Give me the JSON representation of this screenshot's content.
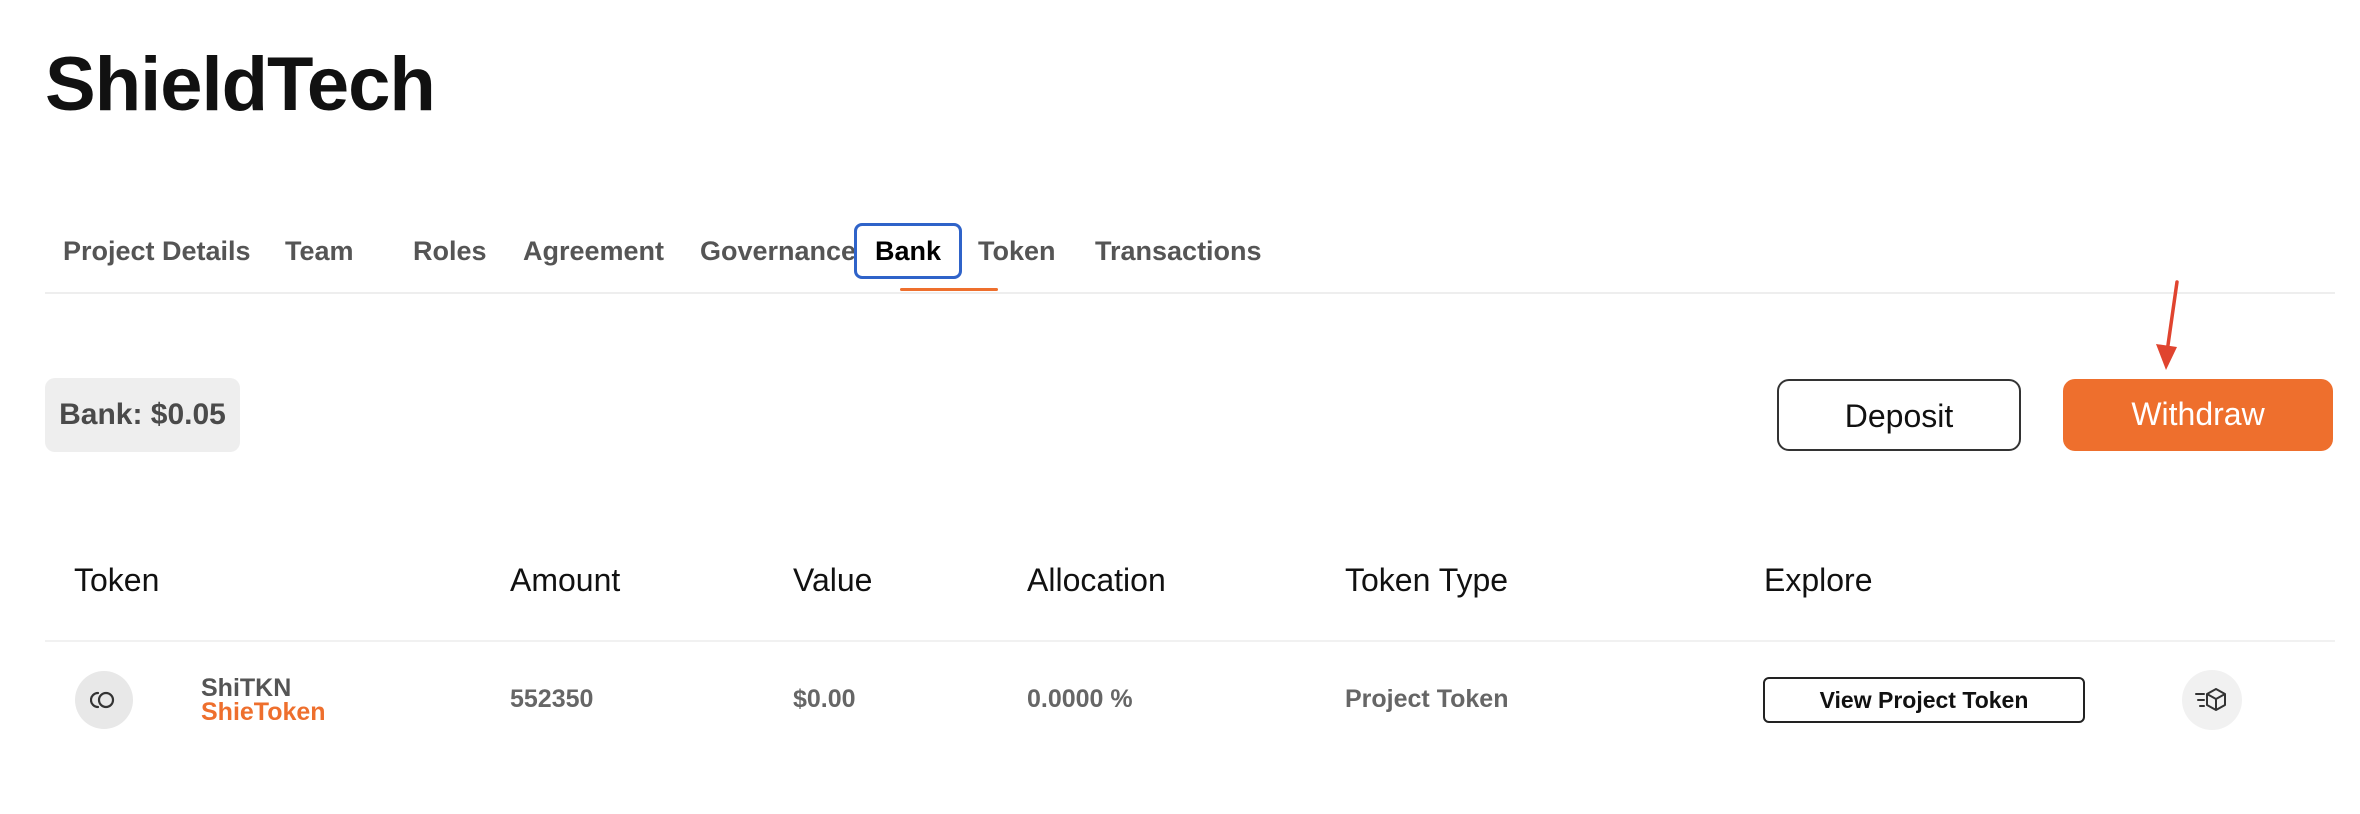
{
  "project": {
    "title": "ShieldTech"
  },
  "tabs": [
    {
      "label": "Project Details"
    },
    {
      "label": "Team"
    },
    {
      "label": "Roles"
    },
    {
      "label": "Agreement"
    },
    {
      "label": "Governance"
    },
    {
      "label": "Bank",
      "active": true
    },
    {
      "label": "Token"
    },
    {
      "label": "Transactions"
    }
  ],
  "bank": {
    "balance_label": "Bank: $0.05",
    "deposit_label": "Deposit",
    "withdraw_label": "Withdraw"
  },
  "table": {
    "headers": [
      "Token",
      "Amount",
      "Value",
      "Allocation",
      "Token Type",
      "Explore"
    ],
    "rows": [
      {
        "icon": "token-coin-icon",
        "symbol": "ShiTKN",
        "name": "ShieToken",
        "amount": "552350",
        "value": "$0.00",
        "allocation": "0.0000 %",
        "token_type": "Project Token",
        "explore_label": "View Project Token",
        "explore_icon": "block-explorer-icon"
      }
    ]
  },
  "colors": {
    "accent": "#ee6f2d",
    "focus_ring": "#2f63c9",
    "annotation_arrow": "#e0442f"
  }
}
